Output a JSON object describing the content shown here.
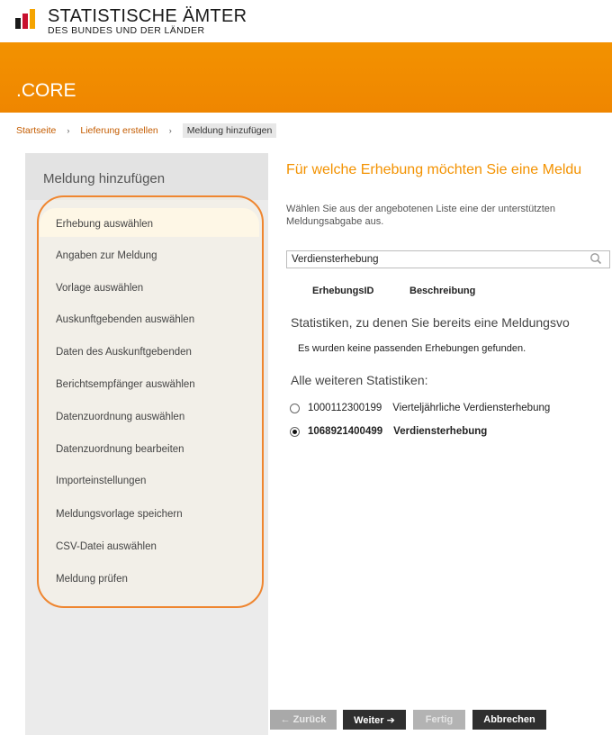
{
  "logo": {
    "title": "STATISTISCHE ÄMTER",
    "subtitle": "DES BUNDES UND DER LÄNDER",
    "icon": "bar-logo-icon",
    "colors": [
      "#1a1a1a",
      "#c8102e",
      "#f5a400"
    ]
  },
  "banner": {
    "title": ".CORE",
    "color": "#f39200"
  },
  "breadcrumb": {
    "items": [
      "Startseite",
      "Lieferung erstellen"
    ],
    "separator": "›",
    "current": "Meldung hinzufügen"
  },
  "sidebar": {
    "title": "Meldung hinzufügen",
    "steps": [
      "Erhebung auswählen",
      "Angaben zur Meldung",
      "Vorlage auswählen",
      "Auskunftgebenden auswählen",
      "Daten des Auskunftgebenden",
      "Berichtsempfänger auswählen",
      "Datenzuordnung auswählen",
      "Datenzuordnung bearbeiten",
      "Importeinstellungen",
      "Meldungsvorlage speichern",
      "CSV-Datei auswählen",
      "Meldung prüfen"
    ]
  },
  "main": {
    "heading": "Für welche Erhebung möchten Sie eine Meldu",
    "intro": "Wählen Sie aus der angebotenen Liste eine der unterstützten Meldungsabgabe aus.",
    "search": {
      "value": "Verdiensterhebung",
      "icon": "search-icon"
    },
    "columns": [
      "ErhebungsID",
      "Beschreibung"
    ],
    "previous_title": "Statistiken, zu denen Sie bereits eine Meldungsvo",
    "no_results": "Es wurden keine passenden Erhebungen gefunden.",
    "others_title": "Alle weiteren Statistiken:",
    "options": [
      {
        "id": "1000112300199",
        "label": "Vierteljährliche Verdiensterhebung",
        "selected": false
      },
      {
        "id": "1068921400499",
        "label": "Verdiensterhebung",
        "selected": true
      }
    ]
  },
  "buttons": {
    "back": "← Zurück",
    "next": "Weiter ➔",
    "done": "Fertig",
    "cancel": "Abbrechen"
  }
}
